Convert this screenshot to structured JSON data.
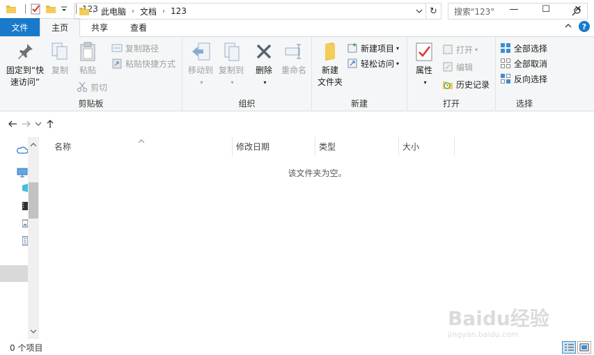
{
  "window": {
    "title": "123",
    "controls": {
      "minimize": "—",
      "maximize": "☐",
      "close": "✕"
    }
  },
  "tabs": [
    {
      "label": "文件"
    },
    {
      "label": "主页"
    },
    {
      "label": "共享"
    },
    {
      "label": "查看"
    }
  ],
  "ribbon": {
    "clipboard": {
      "label": "剪贴板",
      "pin_line1": "固定到“快",
      "pin_line2": "速访问”",
      "copy": "复制",
      "paste": "粘贴",
      "copy_path": "复制路径",
      "paste_shortcut": "粘贴快捷方式",
      "cut": "剪切"
    },
    "organize": {
      "label": "组织",
      "move_to": "移动到",
      "copy_to": "复制到",
      "delete": "删除",
      "rename": "重命名"
    },
    "new": {
      "label": "新建",
      "new_folder_line1": "新建",
      "new_folder_line2": "文件夹",
      "new_item": "新建项目",
      "easy_access": "轻松访问"
    },
    "open": {
      "label": "打开",
      "properties": "属性",
      "open": "打开",
      "edit": "编辑",
      "history": "历史记录"
    },
    "select": {
      "label": "选择",
      "select_all": "全部选择",
      "select_none": "全部取消",
      "invert": "反向选择"
    }
  },
  "address": {
    "crumbs": [
      "此电脑",
      "文档",
      "123"
    ]
  },
  "search": {
    "placeholder": "搜索\"123\""
  },
  "columns": [
    "名称",
    "修改日期",
    "类型",
    "大小"
  ],
  "empty_message": "该文件夹为空。",
  "status": {
    "item_count": "0 个项目"
  },
  "watermark": {
    "brand": "Baidu经验",
    "url": "jingyan.baidu.com"
  },
  "colors": {
    "file_tab": "#1979ca",
    "ribbon_bg": "#f5f6f7",
    "accent": "#1979ca"
  }
}
